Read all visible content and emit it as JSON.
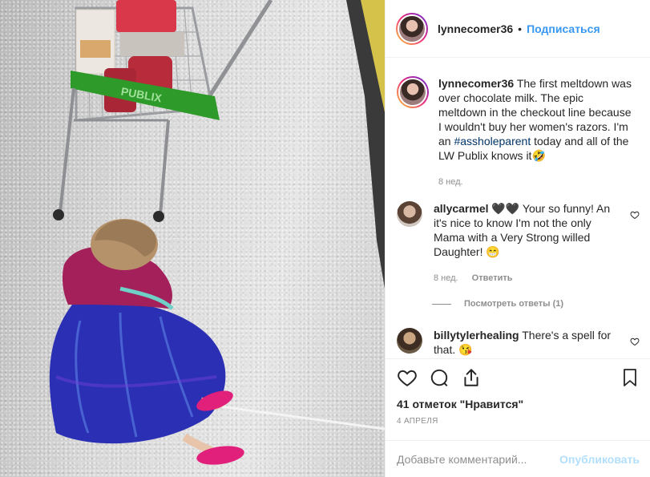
{
  "header": {
    "username": "lynnecomer36",
    "separator": "•",
    "follow_label": "Подписаться"
  },
  "caption": {
    "username": "lynnecomer36",
    "text_before": "The first meltdown was over chocolate milk. The epic meltdown in the checkout line because I wouldn't buy her women's razors. I'm an ",
    "hashtag": "#assholeparent",
    "text_after": " today and all of the LW Publix knows it🤣",
    "time": "8 нед."
  },
  "comments": [
    {
      "username": "allycarmel",
      "text": "🖤🖤 Your so funny! An it's nice to know I'm not the only Mama with a Very Strong willed Daughter! 😁",
      "time": "8 нед.",
      "reply_label": "Ответить",
      "view_replies_label": "Посмотреть ответы (1)"
    },
    {
      "username": "billytylerhealing",
      "text": "There's a spell for that. 😘"
    }
  ],
  "actions": {
    "icons": [
      "heart-icon",
      "comment-icon",
      "share-icon",
      "bookmark-icon"
    ],
    "likes_label": "41 отметок \"Нравится\"",
    "date": "4 АПРЕЛЯ"
  },
  "add_comment": {
    "placeholder": "Добавьте комментарий...",
    "publish_label": "Опубликовать"
  },
  "photo": {
    "cart_label": "PUBLIX"
  },
  "colors": {
    "link": "#3897f0",
    "publish_disabled": "#b2dffc",
    "muted": "#8e8e8e",
    "cart_green": "#2e9a2a"
  }
}
